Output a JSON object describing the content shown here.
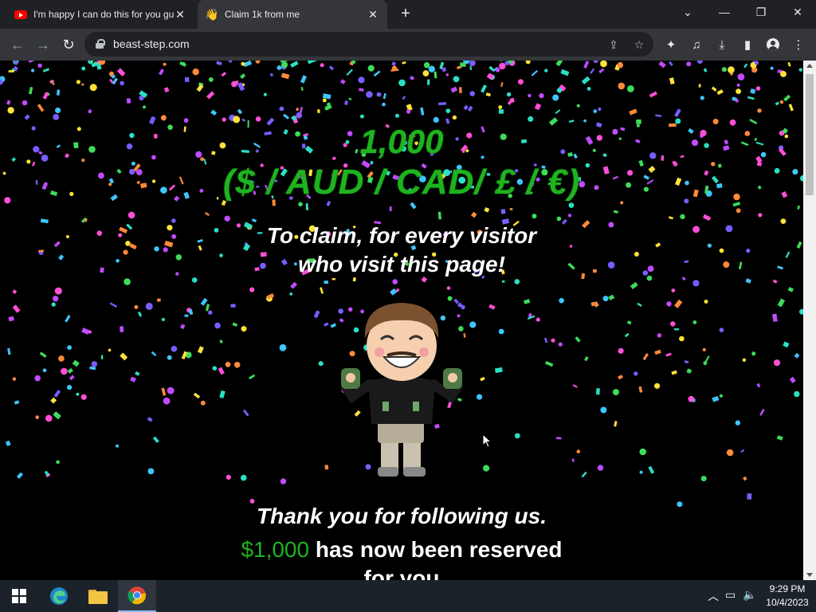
{
  "browser": {
    "tabs": [
      {
        "title": "I'm happy I can do this for you guys",
        "favicon": "youtube-icon",
        "active": false
      },
      {
        "title": "Claim 1k from me",
        "favicon": "waving-hand-icon",
        "active": true
      }
    ],
    "url": "beast-step.com"
  },
  "page": {
    "amount_line1": "1,000",
    "amount_line2": "($ / AUD / CAD/ £ / €)",
    "claim_line1": "To claim, for every visitor",
    "claim_line2": "who visit this page!",
    "thanks": "Thank you for following us.",
    "reserved_amount": "$1,000",
    "reserved_text": " has now been reserved",
    "for_you": "for you"
  },
  "taskbar": {
    "time": "9:29 PM",
    "date": "10/4/2023"
  },
  "colors": {
    "accent_green": "#1fb31f",
    "chrome_dark": "#202124",
    "chrome_toolbar": "#35363a"
  }
}
